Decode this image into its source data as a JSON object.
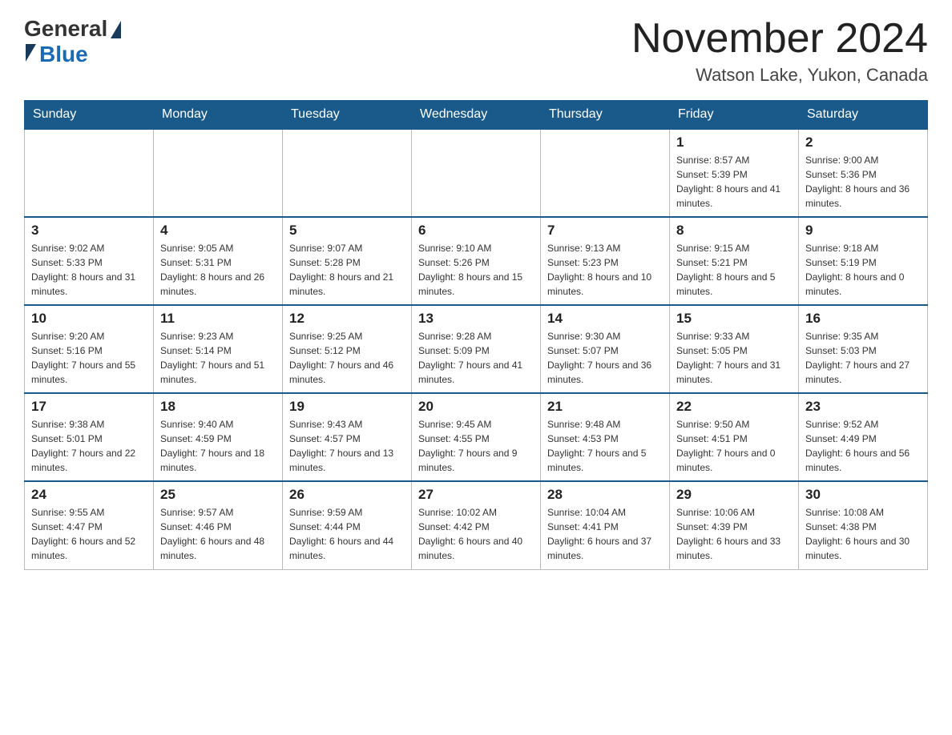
{
  "header": {
    "logo": {
      "general": "General",
      "blue": "Blue"
    },
    "title": "November 2024",
    "location": "Watson Lake, Yukon, Canada"
  },
  "calendar": {
    "days_of_week": [
      "Sunday",
      "Monday",
      "Tuesday",
      "Wednesday",
      "Thursday",
      "Friday",
      "Saturday"
    ],
    "weeks": [
      [
        {
          "day": "",
          "empty": true
        },
        {
          "day": "",
          "empty": true
        },
        {
          "day": "",
          "empty": true
        },
        {
          "day": "",
          "empty": true
        },
        {
          "day": "",
          "empty": true
        },
        {
          "day": "1",
          "sunrise": "Sunrise: 8:57 AM",
          "sunset": "Sunset: 5:39 PM",
          "daylight": "Daylight: 8 hours and 41 minutes."
        },
        {
          "day": "2",
          "sunrise": "Sunrise: 9:00 AM",
          "sunset": "Sunset: 5:36 PM",
          "daylight": "Daylight: 8 hours and 36 minutes."
        }
      ],
      [
        {
          "day": "3",
          "sunrise": "Sunrise: 9:02 AM",
          "sunset": "Sunset: 5:33 PM",
          "daylight": "Daylight: 8 hours and 31 minutes."
        },
        {
          "day": "4",
          "sunrise": "Sunrise: 9:05 AM",
          "sunset": "Sunset: 5:31 PM",
          "daylight": "Daylight: 8 hours and 26 minutes."
        },
        {
          "day": "5",
          "sunrise": "Sunrise: 9:07 AM",
          "sunset": "Sunset: 5:28 PM",
          "daylight": "Daylight: 8 hours and 21 minutes."
        },
        {
          "day": "6",
          "sunrise": "Sunrise: 9:10 AM",
          "sunset": "Sunset: 5:26 PM",
          "daylight": "Daylight: 8 hours and 15 minutes."
        },
        {
          "day": "7",
          "sunrise": "Sunrise: 9:13 AM",
          "sunset": "Sunset: 5:23 PM",
          "daylight": "Daylight: 8 hours and 10 minutes."
        },
        {
          "day": "8",
          "sunrise": "Sunrise: 9:15 AM",
          "sunset": "Sunset: 5:21 PM",
          "daylight": "Daylight: 8 hours and 5 minutes."
        },
        {
          "day": "9",
          "sunrise": "Sunrise: 9:18 AM",
          "sunset": "Sunset: 5:19 PM",
          "daylight": "Daylight: 8 hours and 0 minutes."
        }
      ],
      [
        {
          "day": "10",
          "sunrise": "Sunrise: 9:20 AM",
          "sunset": "Sunset: 5:16 PM",
          "daylight": "Daylight: 7 hours and 55 minutes."
        },
        {
          "day": "11",
          "sunrise": "Sunrise: 9:23 AM",
          "sunset": "Sunset: 5:14 PM",
          "daylight": "Daylight: 7 hours and 51 minutes."
        },
        {
          "day": "12",
          "sunrise": "Sunrise: 9:25 AM",
          "sunset": "Sunset: 5:12 PM",
          "daylight": "Daylight: 7 hours and 46 minutes."
        },
        {
          "day": "13",
          "sunrise": "Sunrise: 9:28 AM",
          "sunset": "Sunset: 5:09 PM",
          "daylight": "Daylight: 7 hours and 41 minutes."
        },
        {
          "day": "14",
          "sunrise": "Sunrise: 9:30 AM",
          "sunset": "Sunset: 5:07 PM",
          "daylight": "Daylight: 7 hours and 36 minutes."
        },
        {
          "day": "15",
          "sunrise": "Sunrise: 9:33 AM",
          "sunset": "Sunset: 5:05 PM",
          "daylight": "Daylight: 7 hours and 31 minutes."
        },
        {
          "day": "16",
          "sunrise": "Sunrise: 9:35 AM",
          "sunset": "Sunset: 5:03 PM",
          "daylight": "Daylight: 7 hours and 27 minutes."
        }
      ],
      [
        {
          "day": "17",
          "sunrise": "Sunrise: 9:38 AM",
          "sunset": "Sunset: 5:01 PM",
          "daylight": "Daylight: 7 hours and 22 minutes."
        },
        {
          "day": "18",
          "sunrise": "Sunrise: 9:40 AM",
          "sunset": "Sunset: 4:59 PM",
          "daylight": "Daylight: 7 hours and 18 minutes."
        },
        {
          "day": "19",
          "sunrise": "Sunrise: 9:43 AM",
          "sunset": "Sunset: 4:57 PM",
          "daylight": "Daylight: 7 hours and 13 minutes."
        },
        {
          "day": "20",
          "sunrise": "Sunrise: 9:45 AM",
          "sunset": "Sunset: 4:55 PM",
          "daylight": "Daylight: 7 hours and 9 minutes."
        },
        {
          "day": "21",
          "sunrise": "Sunrise: 9:48 AM",
          "sunset": "Sunset: 4:53 PM",
          "daylight": "Daylight: 7 hours and 5 minutes."
        },
        {
          "day": "22",
          "sunrise": "Sunrise: 9:50 AM",
          "sunset": "Sunset: 4:51 PM",
          "daylight": "Daylight: 7 hours and 0 minutes."
        },
        {
          "day": "23",
          "sunrise": "Sunrise: 9:52 AM",
          "sunset": "Sunset: 4:49 PM",
          "daylight": "Daylight: 6 hours and 56 minutes."
        }
      ],
      [
        {
          "day": "24",
          "sunrise": "Sunrise: 9:55 AM",
          "sunset": "Sunset: 4:47 PM",
          "daylight": "Daylight: 6 hours and 52 minutes."
        },
        {
          "day": "25",
          "sunrise": "Sunrise: 9:57 AM",
          "sunset": "Sunset: 4:46 PM",
          "daylight": "Daylight: 6 hours and 48 minutes."
        },
        {
          "day": "26",
          "sunrise": "Sunrise: 9:59 AM",
          "sunset": "Sunset: 4:44 PM",
          "daylight": "Daylight: 6 hours and 44 minutes."
        },
        {
          "day": "27",
          "sunrise": "Sunrise: 10:02 AM",
          "sunset": "Sunset: 4:42 PM",
          "daylight": "Daylight: 6 hours and 40 minutes."
        },
        {
          "day": "28",
          "sunrise": "Sunrise: 10:04 AM",
          "sunset": "Sunset: 4:41 PM",
          "daylight": "Daylight: 6 hours and 37 minutes."
        },
        {
          "day": "29",
          "sunrise": "Sunrise: 10:06 AM",
          "sunset": "Sunset: 4:39 PM",
          "daylight": "Daylight: 6 hours and 33 minutes."
        },
        {
          "day": "30",
          "sunrise": "Sunrise: 10:08 AM",
          "sunset": "Sunset: 4:38 PM",
          "daylight": "Daylight: 6 hours and 30 minutes."
        }
      ]
    ]
  }
}
